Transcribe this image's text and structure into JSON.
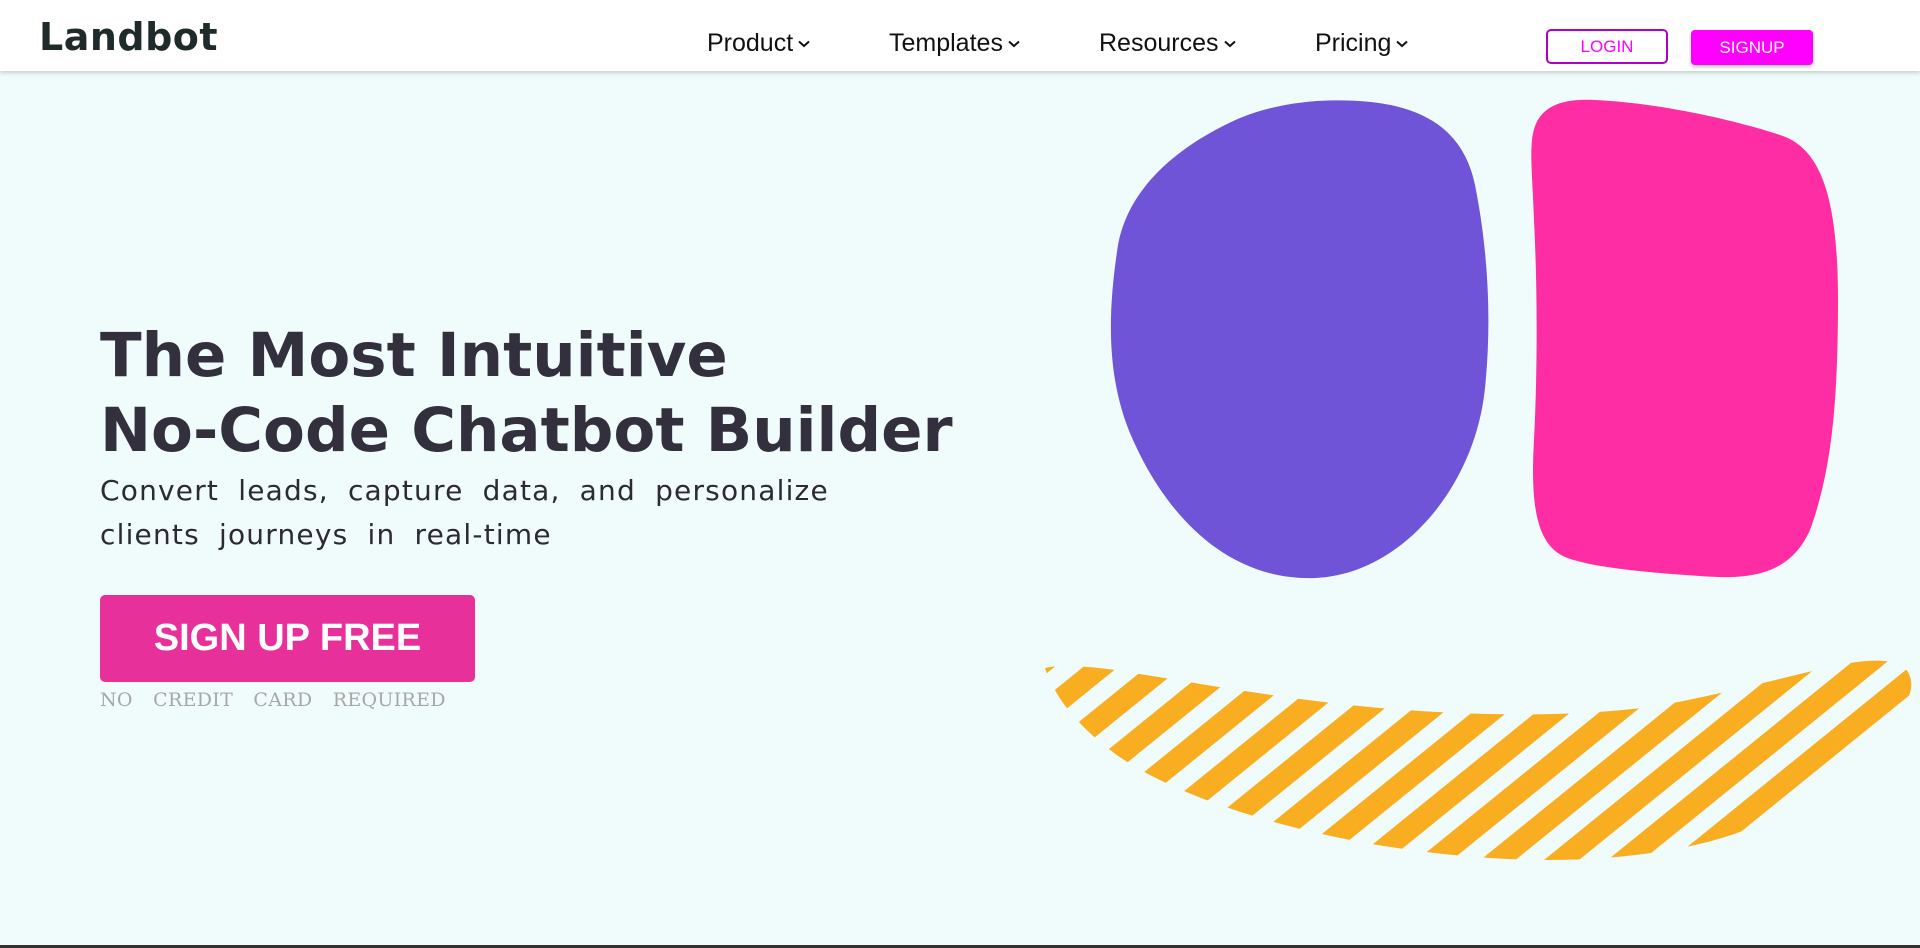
{
  "nav": {
    "logo": "Landbot",
    "items": [
      {
        "label": "Product",
        "icon": "chevron-down-icon"
      },
      {
        "label": "Templates",
        "icon": "chevron-down-icon"
      },
      {
        "label": "Resources",
        "icon": "chevron-down-icon"
      },
      {
        "label": "Pricing",
        "icon": "chevron-down-icon"
      }
    ],
    "login_label": "LOGIN",
    "signup_label": "SIGNUP"
  },
  "hero": {
    "headline_line1": "The Most Intuitive",
    "headline_line2": "No-Code Chatbot Builder",
    "subtitle": "Convert leads, capture data, and personalize clients journeys in real-time",
    "cta_label": "SIGN UP FREE",
    "cta_note": "NO CREDIT CARD REQUIRED"
  },
  "colors": {
    "background": "#f0fcfc",
    "purple_blob": "#6f54d8",
    "pink_blob": "#ff2da3",
    "stripes": "#f9ae22",
    "cta": "#e8309a",
    "signup": "#ff00ff",
    "headline": "#33303d"
  }
}
